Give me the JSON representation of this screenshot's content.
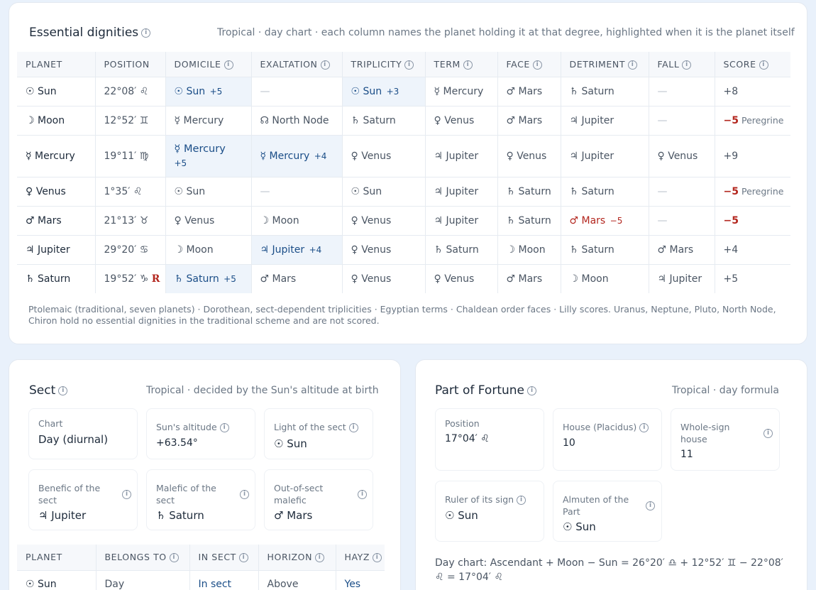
{
  "dignities": {
    "title": "Essential dignities",
    "subtitle": "Tropical · day chart · each column names the planet holding it at that degree, highlighted when it is the planet itself",
    "headers": [
      "PLANET",
      "POSITION",
      "DOMICILE",
      "EXALTATION",
      "TRIPLICITY",
      "TERM",
      "FACE",
      "DETRIMENT",
      "FALL",
      "SCORE"
    ],
    "rows": [
      {
        "planet": "☉  Sun",
        "position": "22°08′ ♌",
        "domicile": "☉ Sun",
        "domicile_pts": "+5",
        "exaltation": "—",
        "triplicity": "☉ Sun",
        "triplicity_pts": "+3",
        "term": "☿ Mercury",
        "face": "♂ Mars",
        "detriment": "♄ Saturn",
        "fall": "—",
        "score": "+8",
        "score_note": ""
      },
      {
        "planet": "☽  Moon",
        "position": "12°52′ ♊",
        "domicile": "☿ Mercury",
        "exaltation": "☊ North Node",
        "triplicity": "♄ Saturn",
        "term": "♀ Venus",
        "face": "♂ Mars",
        "detriment": "♃ Jupiter",
        "fall": "—",
        "score": "−5",
        "score_note": "Peregrine"
      },
      {
        "planet": "☿  Mercury",
        "position": "19°11′ ♍",
        "domicile": "☿ Mercury",
        "domicile_pts": "+5",
        "exaltation": "☿ Mercury",
        "exaltation_pts": "+4",
        "triplicity": "♀ Venus",
        "term": "♃ Jupiter",
        "face": "♀ Venus",
        "detriment": "♃ Jupiter",
        "fall": "♀ Venus",
        "score": "+9",
        "score_note": ""
      },
      {
        "planet": "♀  Venus",
        "position": "1°35′ ♌",
        "domicile": "☉ Sun",
        "exaltation": "—",
        "triplicity": "☉ Sun",
        "term": "♃ Jupiter",
        "face": "♄ Saturn",
        "detriment": "♄ Saturn",
        "fall": "—",
        "score": "−5",
        "score_note": "Peregrine"
      },
      {
        "planet": "♂  Mars",
        "position": "21°13′ ♉",
        "domicile": "♀ Venus",
        "exaltation": "☽ Moon",
        "triplicity": "♀ Venus",
        "term": "♃ Jupiter",
        "face": "♄ Saturn",
        "detriment": "♂ Mars",
        "detriment_pts": "−5",
        "fall": "—",
        "score": "−5",
        "score_note": ""
      },
      {
        "planet": "♃  Jupiter",
        "position": "29°20′ ♋",
        "domicile": "☽ Moon",
        "exaltation": "♃ Jupiter",
        "exaltation_pts": "+4",
        "triplicity": "♀ Venus",
        "term": "♄ Saturn",
        "face": "☽ Moon",
        "detriment": "♄ Saturn",
        "fall": "♂ Mars",
        "score": "+4",
        "score_note": ""
      },
      {
        "planet": "♄  Saturn",
        "position": "19°52′ ♑",
        "retro": "R",
        "domicile": "♄ Saturn",
        "domicile_pts": "+5",
        "exaltation": "♂ Mars",
        "triplicity": "♀ Venus",
        "term": "♀ Venus",
        "face": "♂ Mars",
        "detriment": "☽ Moon",
        "fall": "♃ Jupiter",
        "score": "+5",
        "score_note": ""
      }
    ],
    "footnote": "Ptolemaic (traditional, seven planets) · Dorothean, sect-dependent triplicities · Egyptian terms · Chaldean order faces · Lilly scores. Uranus, Neptune, Pluto, North Node, Chiron hold no essential dignities in the traditional scheme and are not scored."
  },
  "sect": {
    "title": "Sect",
    "subtitle": "Tropical · decided by the Sun's altitude at birth",
    "chart_label": "Chart",
    "chart_value": "Day (diurnal)",
    "altitude_label": "Sun's altitude",
    "altitude_value": "+63.54°",
    "light_label": "Light of the sect",
    "light_value": "☉ Sun",
    "benefic_label": "Benefic of the sect",
    "benefic_value": "♃ Jupiter",
    "malefic_label": "Malefic of the sect",
    "malefic_value": "♄ Saturn",
    "outsect_label": "Out-of-sect malefic",
    "outsect_value": "♂ Mars",
    "table_headers": [
      "PLANET",
      "BELONGS TO",
      "IN SECT",
      "HORIZON",
      "HAYZ"
    ],
    "table_row": {
      "planet": "☉  Sun",
      "belongs": "Day",
      "insect": "In sect",
      "horizon": "Above",
      "hayz": "Yes"
    }
  },
  "fortune": {
    "title": "Part of Fortune",
    "subtitle": "Tropical · day formula",
    "position_label": "Position",
    "position_value": "17°04′ ♌",
    "house_label": "House (Placidus)",
    "house_value": "10",
    "whole_label": "Whole-sign house",
    "whole_value": "11",
    "ruler_label": "Ruler of its sign",
    "ruler_value": "☉ Sun",
    "almuten_label": "Almuten of the Part",
    "almuten_value": "☉ Sun",
    "formula": "Day chart: Ascendant + Moon − Sun = 26°20′ ♎ + 12°52′ ♊ − 22°08′ ♌ = 17°04′ ♌"
  },
  "colors": {
    "accent": "#1a4d87",
    "negative": "#b3261e",
    "highlight": "#eef4fb",
    "background": "#e9f1fb"
  }
}
